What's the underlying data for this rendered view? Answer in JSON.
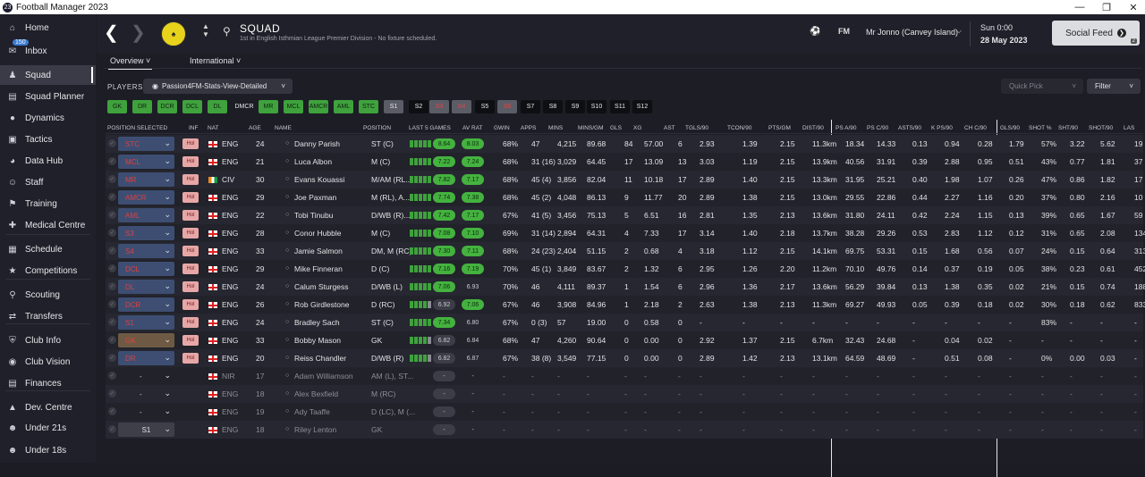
{
  "window": {
    "title": "Football Manager 2023",
    "app_badge": "23"
  },
  "sidebar": {
    "inbox_badge": "150",
    "items": [
      {
        "label": "Home",
        "icon": "home-icon"
      },
      {
        "label": "Inbox",
        "icon": "inbox-icon"
      },
      {
        "label": "Squad",
        "icon": "squad-icon"
      },
      {
        "label": "Squad Planner",
        "icon": "squad-planner-icon"
      },
      {
        "label": "Dynamics",
        "icon": "dynamics-icon"
      },
      {
        "label": "Tactics",
        "icon": "tactics-icon"
      },
      {
        "label": "Data Hub",
        "icon": "data-hub-icon"
      },
      {
        "label": "Staff",
        "icon": "staff-icon"
      },
      {
        "label": "Training",
        "icon": "training-icon"
      },
      {
        "label": "Medical Centre",
        "icon": "medical-icon"
      },
      {
        "label": "Schedule",
        "icon": "calendar-icon"
      },
      {
        "label": "Competitions",
        "icon": "trophy-icon"
      },
      {
        "label": "Scouting",
        "icon": "scouting-icon"
      },
      {
        "label": "Transfers",
        "icon": "transfers-icon"
      },
      {
        "label": "Club Info",
        "icon": "shield-icon"
      },
      {
        "label": "Club Vision",
        "icon": "vision-icon"
      },
      {
        "label": "Finances",
        "icon": "finances-icon"
      },
      {
        "label": "Dev. Centre",
        "icon": "dev-centre-icon"
      },
      {
        "label": "Under 21s",
        "icon": "u21-icon"
      },
      {
        "label": "Under 18s",
        "icon": "u18-icon"
      }
    ]
  },
  "header": {
    "title": "SQUAD",
    "subtitle": "1st in English Isthmian League Premier Division - No fixture scheduled.",
    "fm_label": "FM",
    "manager": "Mr Jonno (Canvey Island)",
    "date_day": "Sun 0:00",
    "date": "28 May 2023",
    "social_feed": "Social Feed",
    "social_count": "2"
  },
  "tabs": [
    {
      "label": "Overview"
    },
    {
      "label": "International"
    }
  ],
  "players_label": "PLAYERS",
  "view_select": "Passion4FM-Stats-View-Detailed",
  "quick_pick": "Quick Pick",
  "filter": "Filter",
  "formation_chips": [
    {
      "label": "GK",
      "style": "green"
    },
    {
      "label": "DR",
      "style": "green"
    },
    {
      "label": "DCR",
      "style": "green"
    },
    {
      "label": "DCL",
      "style": "green"
    },
    {
      "label": "DL",
      "style": "green"
    },
    {
      "label": "DMCR",
      "style": "plain"
    },
    {
      "label": "MR",
      "style": "green"
    },
    {
      "label": "MCL",
      "style": "green"
    },
    {
      "label": "AMCR",
      "style": "green"
    },
    {
      "label": "AML",
      "style": "green"
    },
    {
      "label": "STC",
      "style": "green"
    },
    {
      "label": "S1",
      "style": "grey"
    },
    {
      "label": "S2",
      "style": "dark"
    },
    {
      "label": "S3",
      "style": "red"
    },
    {
      "label": "S4",
      "style": "red"
    },
    {
      "label": "S5",
      "style": "dark"
    },
    {
      "label": "S6",
      "style": "red"
    },
    {
      "label": "S7",
      "style": "dark"
    },
    {
      "label": "S8",
      "style": "dark"
    },
    {
      "label": "S9",
      "style": "dark"
    },
    {
      "label": "S10",
      "style": "dark"
    },
    {
      "label": "S11",
      "style": "dark"
    },
    {
      "label": "S12",
      "style": "dark"
    }
  ],
  "columns": [
    "POSITION SELECTED",
    "INF",
    "NAT",
    "AGE",
    "NAME",
    "POSITION",
    "LAST 5 GAMES",
    "AV RAT",
    "GWIN",
    "APPS",
    "MINS",
    "MINS/GM",
    "GLS",
    "XG",
    "AST",
    "TGLS/90",
    "TCON/90",
    "PTS/GM",
    "DIST/90",
    "PS A/90",
    "PS C/90",
    "ASTS/90",
    "K PS/90",
    "CH C/90",
    "GLS/90",
    "SHOT %",
    "SHT/90",
    "SHOT/90",
    "LAS"
  ],
  "players": [
    {
      "sel": "STC",
      "dd": "blue",
      "inf": "Hol",
      "nat": "ENG",
      "flag": "eng",
      "age": "24",
      "name": "Danny Parish",
      "pos": "ST (C)",
      "form": [
        1,
        1,
        1,
        1,
        1
      ],
      "last5": "8.64",
      "last5s": "green",
      "avrat": "8.03",
      "avs": "green",
      "gwin": "68%",
      "apps": "47",
      "mins": "4,215",
      "minsgm": "89.68",
      "gls": "84",
      "xg": "57.00",
      "ast": "6",
      "tgls": "2.93",
      "tcon": "1.39",
      "pts": "2.15",
      "dist": "11.3km",
      "psa": "18.34",
      "psc": "14.33",
      "asts": "0.13",
      "kps": "0.94",
      "chc": "0.28",
      "gls90": "1.79",
      "shotpct": "57%",
      "sht90": "3.22",
      "shot90": "5.62",
      "las": "19"
    },
    {
      "sel": "MCL",
      "dd": "blue",
      "inf": "Hol",
      "nat": "ENG",
      "flag": "eng",
      "age": "21",
      "name": "Luca Albon",
      "pos": "M (C)",
      "form": [
        1,
        1,
        1,
        1,
        1
      ],
      "last5": "7.22",
      "last5s": "green",
      "avrat": "7.24",
      "avs": "green",
      "gwin": "68%",
      "apps": "31 (16)",
      "mins": "3,029",
      "minsgm": "64.45",
      "gls": "17",
      "xg": "13.09",
      "ast": "13",
      "tgls": "3.03",
      "tcon": "1.19",
      "pts": "2.15",
      "dist": "13.9km",
      "psa": "40.56",
      "psc": "31.91",
      "asts": "0.39",
      "kps": "2.88",
      "chc": "0.95",
      "gls90": "0.51",
      "shotpct": "43%",
      "sht90": "0.77",
      "shot90": "1.81",
      "las": "37"
    },
    {
      "sel": "MR",
      "dd": "blue",
      "inf": "Hol",
      "nat": "CIV",
      "flag": "civ",
      "age": "30",
      "name": "Evans Kouassi",
      "pos": "M/AM (RL...",
      "form": [
        1,
        1,
        1,
        1,
        1
      ],
      "last5": "7.82",
      "last5s": "green",
      "avrat": "7.17",
      "avs": "green",
      "gwin": "68%",
      "apps": "45 (4)",
      "mins": "3,856",
      "minsgm": "82.04",
      "gls": "11",
      "xg": "10.18",
      "ast": "17",
      "tgls": "2.89",
      "tcon": "1.40",
      "pts": "2.15",
      "dist": "13.3km",
      "psa": "31.95",
      "psc": "25.21",
      "asts": "0.40",
      "kps": "1.98",
      "chc": "1.07",
      "gls90": "0.26",
      "shotpct": "47%",
      "sht90": "0.86",
      "shot90": "1.82",
      "las": "17"
    },
    {
      "sel": "AMCR",
      "dd": "blue",
      "inf": "Hol",
      "nat": "ENG",
      "flag": "eng",
      "age": "29",
      "name": "Joe Paxman",
      "pos": "M (RL), A...",
      "form": [
        1,
        1,
        1,
        1,
        1
      ],
      "last5": "7.74",
      "last5s": "green",
      "avrat": "7.38",
      "avs": "green",
      "gwin": "68%",
      "apps": "45 (2)",
      "mins": "4,048",
      "minsgm": "86.13",
      "gls": "9",
      "xg": "11.77",
      "ast": "20",
      "tgls": "2.89",
      "tcon": "1.38",
      "pts": "2.15",
      "dist": "13.0km",
      "psa": "29.55",
      "psc": "22.86",
      "asts": "0.44",
      "kps": "2.27",
      "chc": "1.16",
      "gls90": "0.20",
      "shotpct": "37%",
      "sht90": "0.80",
      "shot90": "2.16",
      "las": "10"
    },
    {
      "sel": "AML",
      "dd": "blue",
      "inf": "Hol",
      "nat": "ENG",
      "flag": "eng",
      "age": "22",
      "name": "Tobi Tinubu",
      "pos": "D/WB (R)...",
      "form": [
        1,
        1,
        1,
        1,
        1
      ],
      "last5": "7.42",
      "last5s": "green",
      "avrat": "7.17",
      "avs": "green",
      "gwin": "67%",
      "apps": "41 (5)",
      "mins": "3,456",
      "minsgm": "75.13",
      "gls": "5",
      "xg": "6.51",
      "ast": "16",
      "tgls": "2.81",
      "tcon": "1.35",
      "pts": "2.13",
      "dist": "13.6km",
      "psa": "31.80",
      "psc": "24.11",
      "asts": "0.42",
      "kps": "2.24",
      "chc": "1.15",
      "gls90": "0.13",
      "shotpct": "39%",
      "sht90": "0.65",
      "shot90": "1.67",
      "las": "59"
    },
    {
      "sel": "S3",
      "dd": "blue",
      "inf": "Hol",
      "nat": "ENG",
      "flag": "eng",
      "age": "28",
      "name": "Conor Hubble",
      "pos": "M (C)",
      "form": [
        1,
        1,
        1,
        1,
        1
      ],
      "last5": "7.08",
      "last5s": "green",
      "avrat": "7.10",
      "avs": "green",
      "gwin": "69%",
      "apps": "31 (14)",
      "mins": "2,894",
      "minsgm": "64.31",
      "gls": "4",
      "xg": "7.33",
      "ast": "17",
      "tgls": "3.14",
      "tcon": "1.40",
      "pts": "2.18",
      "dist": "13.7km",
      "psa": "38.28",
      "psc": "29.26",
      "asts": "0.53",
      "kps": "2.83",
      "chc": "1.12",
      "gls90": "0.12",
      "shotpct": "31%",
      "sht90": "0.65",
      "shot90": "2.08",
      "las": "134"
    },
    {
      "sel": "S4",
      "dd": "blue",
      "inf": "Hol",
      "nat": "ENG",
      "flag": "eng",
      "age": "33",
      "name": "Jamie Salmon",
      "pos": "DM, M (RC)",
      "form": [
        1,
        1,
        1,
        1,
        1
      ],
      "last5": "7.30",
      "last5s": "green",
      "avrat": "7.11",
      "avs": "green",
      "gwin": "68%",
      "apps": "24 (23)",
      "mins": "2,404",
      "minsgm": "51.15",
      "gls": "2",
      "xg": "0.68",
      "ast": "4",
      "tgls": "3.18",
      "tcon": "1.12",
      "pts": "2.15",
      "dist": "14.1km",
      "psa": "69.75",
      "psc": "53.31",
      "asts": "0.15",
      "kps": "1.68",
      "chc": "0.56",
      "gls90": "0.07",
      "shotpct": "24%",
      "sht90": "0.15",
      "shot90": "0.64",
      "las": "313"
    },
    {
      "sel": "DCL",
      "dd": "blue",
      "inf": "Hol",
      "nat": "ENG",
      "flag": "eng",
      "age": "29",
      "name": "Mike Finneran",
      "pos": "D (C)",
      "form": [
        1,
        1,
        1,
        1,
        1
      ],
      "last5": "7.16",
      "last5s": "green",
      "avrat": "7.19",
      "avs": "green",
      "gwin": "70%",
      "apps": "45 (1)",
      "mins": "3,849",
      "minsgm": "83.67",
      "gls": "2",
      "xg": "1.32",
      "ast": "6",
      "tgls": "2.95",
      "tcon": "1.26",
      "pts": "2.20",
      "dist": "11.2km",
      "psa": "70.10",
      "psc": "49.76",
      "asts": "0.14",
      "kps": "0.37",
      "chc": "0.19",
      "gls90": "0.05",
      "shotpct": "38%",
      "sht90": "0.23",
      "shot90": "0.61",
      "las": "452"
    },
    {
      "sel": "DL",
      "dd": "blue",
      "inf": "Hol",
      "nat": "ENG",
      "flag": "eng",
      "age": "24",
      "name": "Calum Sturgess",
      "pos": "D/WB (L)",
      "form": [
        1,
        1,
        1,
        1,
        1
      ],
      "last5": "7.06",
      "last5s": "green",
      "avrat": "6.93",
      "avs": "none",
      "gwin": "70%",
      "apps": "46",
      "mins": "4,111",
      "minsgm": "89.37",
      "gls": "1",
      "xg": "1.54",
      "ast": "6",
      "tgls": "2.96",
      "tcon": "1.36",
      "pts": "2.17",
      "dist": "13.6km",
      "psa": "56.29",
      "psc": "39.84",
      "asts": "0.13",
      "kps": "1.38",
      "chc": "0.35",
      "gls90": "0.02",
      "shotpct": "21%",
      "sht90": "0.15",
      "shot90": "0.74",
      "las": "188"
    },
    {
      "sel": "DCR",
      "dd": "blue",
      "inf": "Hol",
      "nat": "ENG",
      "flag": "eng",
      "age": "26",
      "name": "Rob Girdlestone",
      "pos": "D (RC)",
      "form": [
        1,
        1,
        1,
        1,
        0
      ],
      "last5": "6.92",
      "last5s": "grey",
      "avrat": "7.06",
      "avs": "green",
      "gwin": "67%",
      "apps": "46",
      "mins": "3,908",
      "minsgm": "84.96",
      "gls": "1",
      "xg": "2.18",
      "ast": "2",
      "tgls": "2.63",
      "tcon": "1.38",
      "pts": "2.13",
      "dist": "11.3km",
      "psa": "69.27",
      "psc": "49.93",
      "asts": "0.05",
      "kps": "0.39",
      "chc": "0.18",
      "gls90": "0.02",
      "shotpct": "30%",
      "sht90": "0.18",
      "shot90": "0.62",
      "las": "833"
    },
    {
      "sel": "S1",
      "dd": "blue",
      "inf": "Hol",
      "nat": "ENG",
      "flag": "eng",
      "age": "24",
      "name": "Bradley Sach",
      "pos": "ST (C)",
      "form": [
        1,
        1,
        1,
        1,
        1
      ],
      "last5": "7.34",
      "last5s": "green",
      "avrat": "6.80",
      "avs": "none",
      "gwin": "67%",
      "apps": "0 (3)",
      "mins": "57",
      "minsgm": "19.00",
      "gls": "0",
      "xg": "0.58",
      "ast": "0",
      "tgls": "-",
      "tcon": "-",
      "pts": "-",
      "dist": "-",
      "psa": "-",
      "psc": "-",
      "asts": "-",
      "kps": "-",
      "chc": "-",
      "gls90": "-",
      "shotpct": "83%",
      "sht90": "-",
      "shot90": "-",
      "las": "-"
    },
    {
      "sel": "GK",
      "dd": "brown",
      "inf": "Hol",
      "nat": "ENG",
      "flag": "eng",
      "age": "33",
      "name": "Bobby Mason",
      "pos": "GK",
      "form": [
        1,
        1,
        1,
        1,
        0
      ],
      "last5": "6.82",
      "last5s": "grey",
      "avrat": "6.84",
      "avs": "none",
      "gwin": "68%",
      "apps": "47",
      "mins": "4,260",
      "minsgm": "90.64",
      "gls": "0",
      "xg": "0.00",
      "ast": "0",
      "tgls": "2.92",
      "tcon": "1.37",
      "pts": "2.15",
      "dist": "6.7km",
      "psa": "32.43",
      "psc": "24.68",
      "asts": "-",
      "kps": "0.04",
      "chc": "0.02",
      "gls90": "-",
      "shotpct": "-",
      "sht90": "-",
      "shot90": "-",
      "las": "-"
    },
    {
      "sel": "DR",
      "dd": "blue",
      "inf": "Hol",
      "nat": "ENG",
      "flag": "eng",
      "age": "20",
      "name": "Reiss Chandler",
      "pos": "D/WB (R)",
      "form": [
        1,
        1,
        1,
        1,
        0
      ],
      "last5": "6.82",
      "last5s": "grey",
      "avrat": "6.87",
      "avs": "none",
      "gwin": "67%",
      "apps": "38 (8)",
      "mins": "3,549",
      "minsgm": "77.15",
      "gls": "0",
      "xg": "0.00",
      "ast": "0",
      "tgls": "2.89",
      "tcon": "1.42",
      "pts": "2.13",
      "dist": "13.1km",
      "psa": "64.59",
      "psc": "48.69",
      "asts": "-",
      "kps": "0.51",
      "chc": "0.08",
      "gls90": "-",
      "shotpct": "0%",
      "sht90": "0.00",
      "shot90": "0.03",
      "las": "-"
    },
    {
      "sel": "-",
      "dd": "none",
      "inf": "",
      "nat": "NIR",
      "flag": "nir",
      "age": "17",
      "name": "Adam Williamson",
      "pos": "AM (L), ST...",
      "form": [],
      "last5": "-",
      "last5s": "dash",
      "avrat": "-",
      "avs": "none",
      "gwin": "-",
      "apps": "-",
      "mins": "-",
      "minsgm": "-",
      "gls": "-",
      "xg": "-",
      "ast": "-",
      "tgls": "-",
      "tcon": "-",
      "pts": "-",
      "dist": "-",
      "psa": "-",
      "psc": "-",
      "asts": "-",
      "kps": "-",
      "chc": "-",
      "gls90": "-",
      "shotpct": "-",
      "sht90": "-",
      "shot90": "-",
      "las": "-",
      "inactive": true
    },
    {
      "sel": "-",
      "dd": "none",
      "inf": "",
      "nat": "ENG",
      "flag": "eng",
      "age": "18",
      "name": "Alex Bexfield",
      "pos": "M (RC)",
      "form": [],
      "last5": "-",
      "last5s": "dash",
      "avrat": "-",
      "avs": "none",
      "gwin": "-",
      "apps": "-",
      "mins": "-",
      "minsgm": "-",
      "gls": "-",
      "xg": "-",
      "ast": "-",
      "tgls": "-",
      "tcon": "-",
      "pts": "-",
      "dist": "-",
      "psa": "-",
      "psc": "-",
      "asts": "-",
      "kps": "-",
      "chc": "-",
      "gls90": "-",
      "shotpct": "-",
      "sht90": "-",
      "shot90": "-",
      "las": "-",
      "inactive": true
    },
    {
      "sel": "-",
      "dd": "none",
      "inf": "",
      "nat": "ENG",
      "flag": "eng",
      "age": "19",
      "name": "Ady Taaffe",
      "pos": "D (LC), M (...",
      "form": [],
      "last5": "-",
      "last5s": "dash",
      "avrat": "-",
      "avs": "none",
      "gwin": "-",
      "apps": "-",
      "mins": "-",
      "minsgm": "-",
      "gls": "-",
      "xg": "-",
      "ast": "-",
      "tgls": "-",
      "tcon": "-",
      "pts": "-",
      "dist": "-",
      "psa": "-",
      "psc": "-",
      "asts": "-",
      "kps": "-",
      "chc": "-",
      "gls90": "-",
      "shotpct": "-",
      "sht90": "-",
      "shot90": "-",
      "las": "-",
      "inactive": true
    },
    {
      "sel": "S1",
      "dd": "plain",
      "inf": "",
      "nat": "ENG",
      "flag": "eng",
      "age": "18",
      "name": "Riley Lenton",
      "pos": "GK",
      "form": [],
      "last5": "-",
      "last5s": "dash",
      "avrat": "-",
      "avs": "none",
      "gwin": "-",
      "apps": "-",
      "mins": "-",
      "minsgm": "-",
      "gls": "-",
      "xg": "-",
      "ast": "-",
      "tgls": "-",
      "tcon": "-",
      "pts": "-",
      "dist": "-",
      "psa": "-",
      "psc": "-",
      "asts": "-",
      "kps": "-",
      "chc": "-",
      "gls90": "-",
      "shotpct": "-",
      "sht90": "-",
      "shot90": "-",
      "las": "-",
      "inactive": true
    }
  ]
}
